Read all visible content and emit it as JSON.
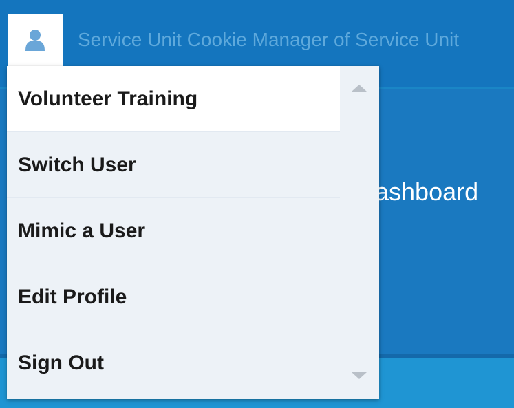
{
  "header": {
    "user_title": "Service Unit Cookie Manager of Service Unit",
    "user_icon": "user-icon"
  },
  "background": {
    "heading": "ashboard"
  },
  "menu": {
    "items": [
      {
        "label": "Volunteer Training",
        "active": true
      },
      {
        "label": "Switch User",
        "active": false
      },
      {
        "label": "Mimic a User",
        "active": false
      },
      {
        "label": "Edit Profile",
        "active": false
      },
      {
        "label": "Sign Out",
        "active": false
      }
    ]
  },
  "colors": {
    "topbar": "#1475be",
    "accent": "#1f95d3",
    "menu_bg": "#edf2f7",
    "menu_active_bg": "#ffffff"
  }
}
